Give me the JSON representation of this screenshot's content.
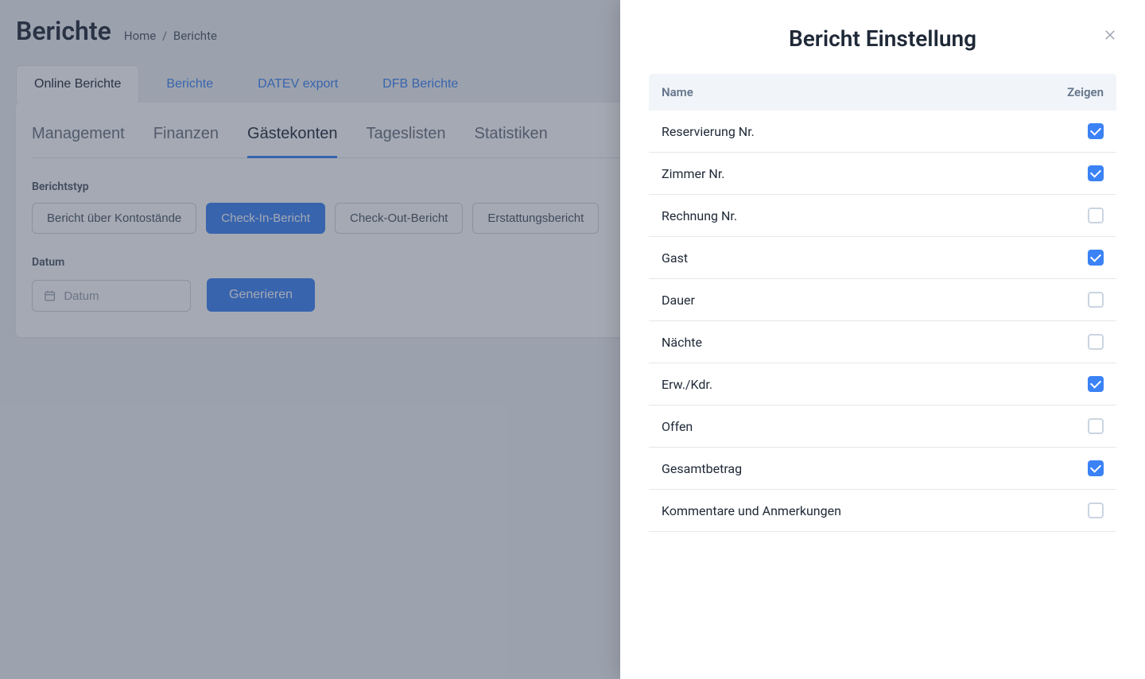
{
  "page": {
    "title": "Berichte",
    "breadcrumb_home": "Home",
    "breadcrumb_current": "Berichte"
  },
  "primary_tabs": [
    {
      "label": "Online Berichte",
      "active": true
    },
    {
      "label": "Berichte",
      "active": false
    },
    {
      "label": "DATEV export",
      "active": false
    },
    {
      "label": "DFB Berichte",
      "active": false
    }
  ],
  "secondary_tabs": [
    {
      "label": "Management",
      "active": false
    },
    {
      "label": "Finanzen",
      "active": false
    },
    {
      "label": "Gästekonten",
      "active": true
    },
    {
      "label": "Tageslisten",
      "active": false
    },
    {
      "label": "Statistiken",
      "active": false
    }
  ],
  "report_type_label": "Berichtstyp",
  "report_types": [
    {
      "label": "Bericht über Kontostände",
      "active": false
    },
    {
      "label": "Check-In-Bericht",
      "active": true
    },
    {
      "label": "Check-Out-Bericht",
      "active": false
    },
    {
      "label": "Erstattungsbericht",
      "active": false
    }
  ],
  "date_label": "Datum",
  "date_placeholder": "Datum",
  "generate_label": "Generieren",
  "panel": {
    "title": "Bericht Einstellung",
    "col_name": "Name",
    "col_show": "Zeigen",
    "rows": [
      {
        "label": "Reservierung Nr.",
        "checked": true
      },
      {
        "label": "Zimmer Nr.",
        "checked": true
      },
      {
        "label": "Rechnung Nr.",
        "checked": false
      },
      {
        "label": "Gast",
        "checked": true
      },
      {
        "label": "Dauer",
        "checked": false
      },
      {
        "label": "Nächte",
        "checked": false
      },
      {
        "label": "Erw./Kdr.",
        "checked": true
      },
      {
        "label": "Offen",
        "checked": false
      },
      {
        "label": "Gesamtbetrag",
        "checked": true
      },
      {
        "label": "Kommentare und Anmerkungen",
        "checked": false
      }
    ]
  }
}
